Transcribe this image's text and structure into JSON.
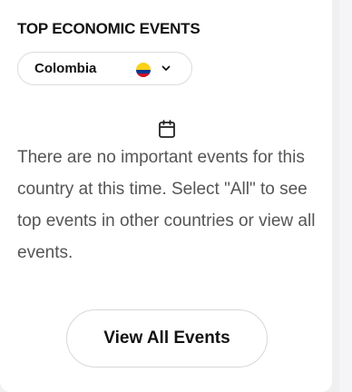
{
  "widget": {
    "title": "TOP ECONOMIC EVENTS",
    "country_selector": {
      "selected": "Colombia",
      "flag_icon": "colombia-flag-icon",
      "flag_colors": [
        "#fcd116",
        "#003893",
        "#ce1126"
      ],
      "dropdown_icon": "chevron-down-icon"
    },
    "empty_state": {
      "icon": "calendar-icon",
      "message": "There are no important events for this country at this time. Select \"All\" to see top events in other countries or view all events."
    },
    "view_all_label": "View All Events"
  }
}
